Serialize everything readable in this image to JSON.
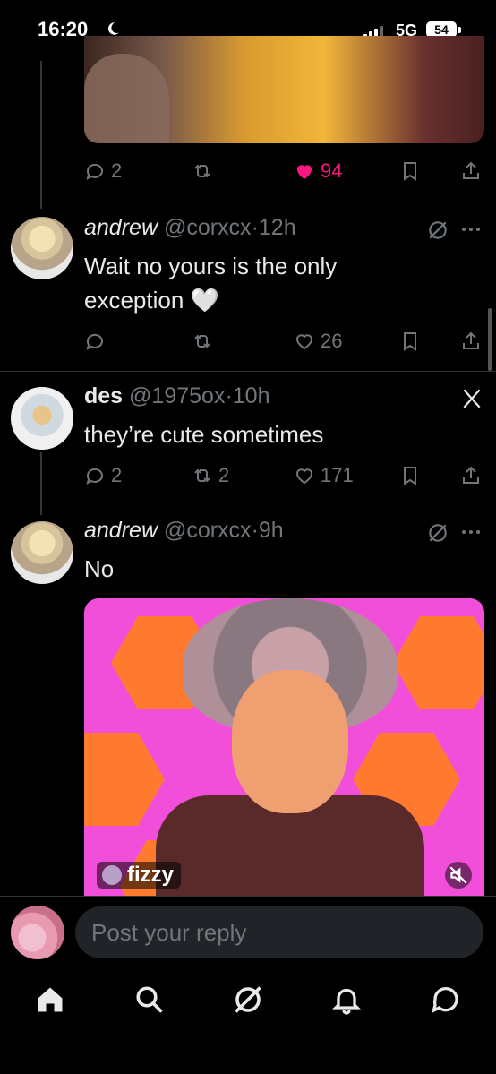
{
  "status_bar": {
    "time": "16:20",
    "network": "5G",
    "battery": "54"
  },
  "posts": [
    {
      "id": "p0",
      "stats": {
        "replies": "2",
        "reposts": "",
        "likes": "94",
        "liked": true
      }
    },
    {
      "id": "p1",
      "display_name": "andrew",
      "handle": "@corxcx",
      "time": "12h",
      "text": "Wait no yours is the only exception 🤍",
      "stats": {
        "replies": "",
        "reposts": "",
        "likes": "26"
      }
    },
    {
      "id": "p2",
      "display_name": "des",
      "handle": "@1975ox",
      "time": "10h",
      "text": "they’re cute sometimes",
      "stats": {
        "replies": "2",
        "reposts": "2",
        "likes": "171"
      }
    },
    {
      "id": "p3",
      "display_name": "andrew",
      "handle": "@corxcx",
      "time": "9h",
      "text": "No",
      "media_tag": "fizzy"
    }
  ],
  "reply": {
    "placeholder": "Post your reply"
  },
  "icons": {
    "reply": "comment-icon",
    "repost": "repost-icon",
    "like": "heart-icon",
    "bookmark": "bookmark-icon",
    "share": "share-icon",
    "grok": "grok-icon",
    "more": "more-icon",
    "x_logo": "x-logo-icon"
  },
  "colors": {
    "like": "#f91880",
    "muted": "#71767b",
    "text": "#e7e9ea"
  }
}
